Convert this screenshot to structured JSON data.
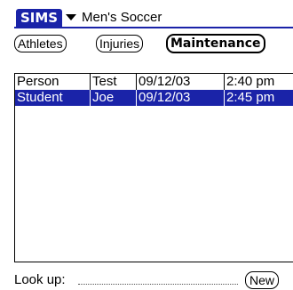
{
  "app": {
    "title": "SIMS",
    "category": "Men's Soccer"
  },
  "tabs": [
    {
      "label": "Athletes",
      "selected": false
    },
    {
      "label": "Injuries",
      "selected": false
    },
    {
      "label": "Maintenance",
      "selected": true
    }
  ],
  "table": {
    "rows": [
      {
        "person": "Person",
        "test": "Test",
        "date": "09/12/03",
        "time": "2:40 pm",
        "selected": false
      },
      {
        "person": "Student",
        "test": "Joe",
        "date": "09/12/03",
        "time": "2:45 pm",
        "selected": true
      }
    ]
  },
  "footer": {
    "lookup_label": "Look up:",
    "lookup_value": "",
    "new_label": "New"
  },
  "colors": {
    "accent": "#1a23a8",
    "background": "#ffffff",
    "text": "#000000"
  }
}
